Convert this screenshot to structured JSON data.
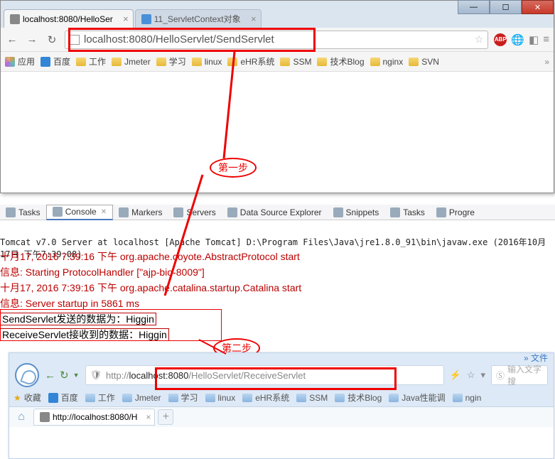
{
  "chrome": {
    "tabs": [
      {
        "label": "localhost:8080/HelloSer",
        "active": true
      },
      {
        "label": "11_ServletContext对象",
        "active": false
      }
    ],
    "url_full": "localhost:8080/HelloServlet/SendServlet",
    "bookmarks": {
      "apps": "应用",
      "baidu": "百度",
      "work": "工作",
      "jmeter": "Jmeter",
      "study": "学习",
      "linux": "linux",
      "ehr": "eHR系统",
      "ssm": "SSM",
      "techblog": "技术Blog",
      "nginx": "nginx",
      "svn": "SVN"
    }
  },
  "annot": {
    "step1": "第一步",
    "step2": "第二步"
  },
  "eclipse": {
    "views": {
      "tasks": "Tasks",
      "console": "Console",
      "markers": "Markers",
      "servers": "Servers",
      "dse": "Data Source Explorer",
      "snippets": "Snippets",
      "tasks2": "Tasks",
      "progress": "Progre"
    },
    "console_head": "Tomcat v7.0 Server at localhost [Apache Tomcat] D:\\Program Files\\Java\\jre1.8.0_91\\bin\\javaw.exe (2016年10月17日 下午7:39:08)",
    "lines": {
      "l1a": "十月17, 2016 7:39:16 下午",
      "l1b": "org.apache.coyote.AbstractProtocol start",
      "l2": "信息: Starting ProtocolHandler [\"ajp-bio-8009\"]",
      "l3a": "十月17, 2016 7:39:16 下午",
      "l3b": "org.apache.catalina.startup.Catalina start",
      "l4a": "信息: Server startup in",
      "l4b": "5861 ms",
      "l5": "SendServlet发送的数据为：Higgin",
      "l6": "ReceiveServlet接收到的数据：Higgin"
    }
  },
  "sg": {
    "files": "» 文件",
    "url_gray_pre": "http://",
    "url_black": "localhost:8080",
    "url_gray_post": "/HelloServlet/ReceiveServlet",
    "search_placeholder": "输入文字搜",
    "bookmarks": {
      "fav": "收藏",
      "baidu": "百度",
      "work": "工作",
      "jmeter": "Jmeter",
      "study": "学习",
      "linux": "linux",
      "ehr": "eHR系统",
      "ssm": "SSM",
      "techblog": "技术Blog",
      "javaperf": "Java性能调",
      "nginx": "ngin"
    },
    "tab_label": "http://localhost:8080/H"
  }
}
